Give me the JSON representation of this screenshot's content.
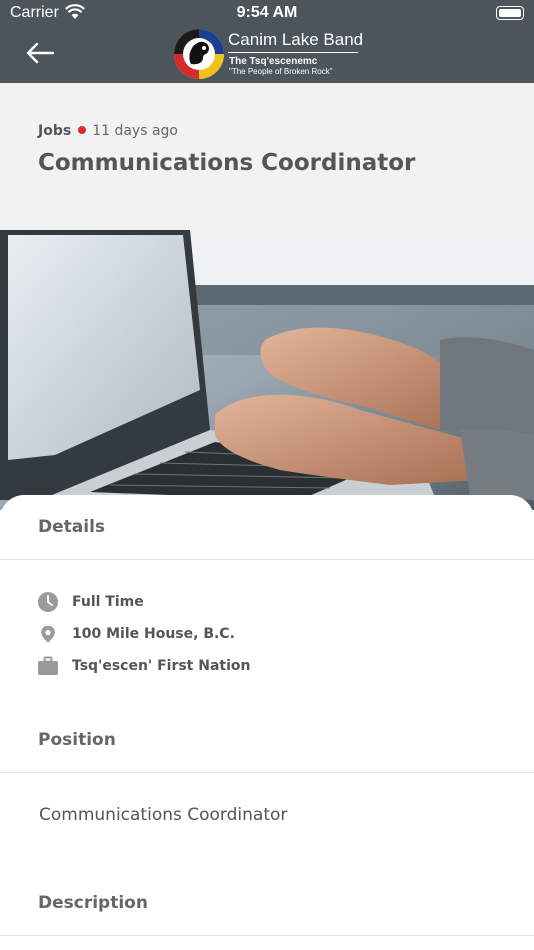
{
  "status": {
    "carrier": "Carrier",
    "time": "9:54 AM"
  },
  "header": {
    "brand_name": "Canim Lake Band",
    "brand_sub": "The Tsq'escenemc",
    "brand_tagline": "\"The People of Broken Rock\"",
    "bg_color": "#4c545c"
  },
  "job": {
    "category": "Jobs",
    "posted": "11 days ago",
    "title": "Communications Coordinator"
  },
  "details": {
    "heading": "Details",
    "items": [
      {
        "icon": "clock-icon",
        "text": "Full Time"
      },
      {
        "icon": "location-pin-icon",
        "text": "100 Mile House, B.C."
      },
      {
        "icon": "briefcase-icon",
        "text": "Tsq'escen' First Nation"
      }
    ]
  },
  "position": {
    "heading": "Position",
    "text": "Communications Coordinator"
  },
  "description": {
    "heading": "Description"
  }
}
